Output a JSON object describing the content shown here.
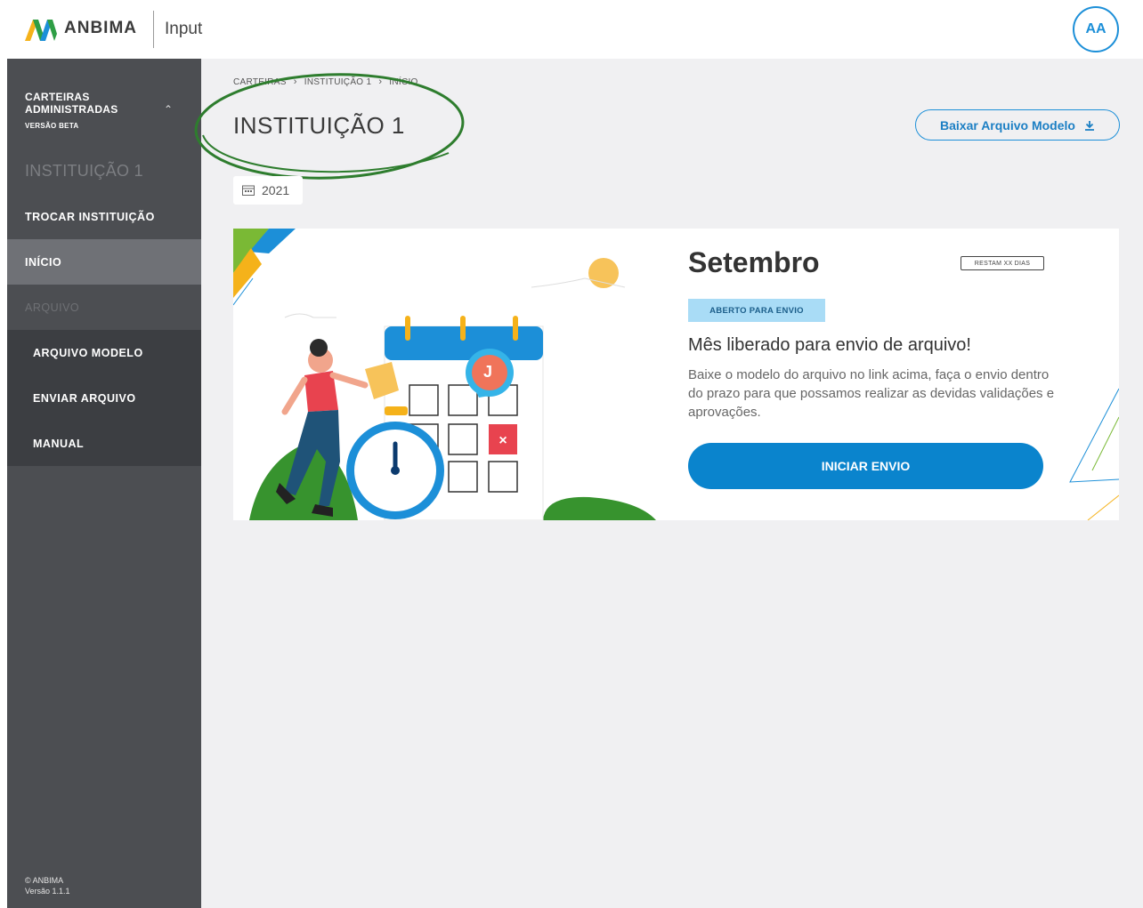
{
  "header": {
    "brand": "ANBIMA",
    "product": "Input",
    "avatar_initials": "AA"
  },
  "sidebar": {
    "section_title": "CARTEIRAS ADMINISTRADAS",
    "section_badge": "VERSÃO BETA",
    "institution": "INSTITUIÇÃO 1",
    "items": [
      {
        "label": "TROCAR INSTITUIÇÃO"
      },
      {
        "label": "INÍCIO",
        "active": true
      },
      {
        "label": "ARQUIVO"
      }
    ],
    "subitems": [
      {
        "label": "ARQUIVO MODELO"
      },
      {
        "label": "ENVIAR ARQUIVO"
      },
      {
        "label": "MANUAL"
      }
    ],
    "footer": {
      "copyright": "© ANBIMA",
      "version": "Versão 1.1.1"
    }
  },
  "main": {
    "breadcrumb": [
      "CARTEIRAS",
      "INSTITUIÇÃO 1",
      "INÍCIO"
    ],
    "title": "INSTITUIÇÃO 1",
    "download_label": "Baixar Arquivo Modelo",
    "year": "2021",
    "card": {
      "month": "Setembro",
      "remaining": "RESTAM XX DIAS",
      "status": "ABERTO PARA ENVIO",
      "headline": "Mês liberado para envio de arquivo!",
      "description": "Baixe o modelo do arquivo no link acima, faça o envio dentro do prazo para que possamos realizar as devidas validações e aprovações.",
      "button_label": "INICIAR ENVIO",
      "avatar_letter": "J"
    }
  },
  "colors": {
    "accent": "#0a84cd",
    "sidebar_bg": "#4c4e52",
    "sidebar_submenu_bg": "#3c3e42",
    "sidebar_active": "#6f7176",
    "badge_bg": "#a9dcf6",
    "annotation": "#2e7d2e"
  },
  "icons": {
    "logo": "anbima-logo-icon",
    "collapse": "chevron-up-icon",
    "download": "download-icon",
    "calendar": "calendar-icon",
    "breadcrumb_separator": "chevron-right-icon"
  }
}
